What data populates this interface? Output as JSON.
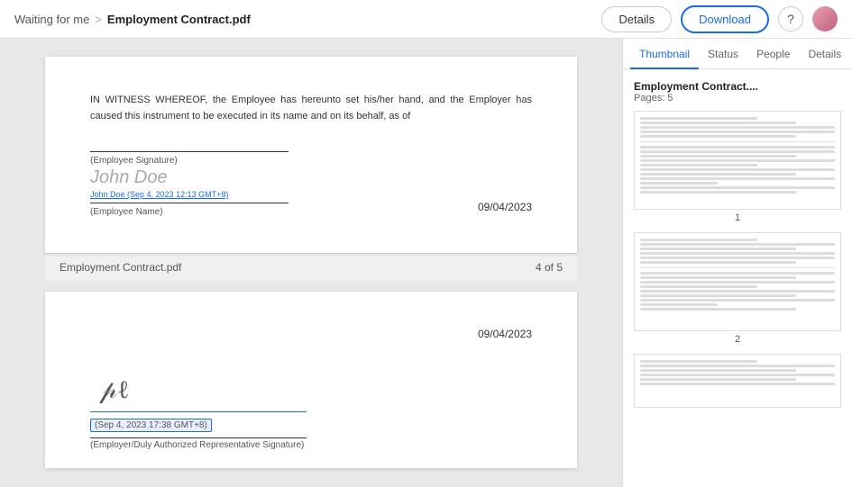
{
  "header": {
    "breadcrumb_waiting": "Waiting for me",
    "breadcrumb_separator": ">",
    "filename": "Employment Contract.pdf",
    "btn_details": "Details",
    "btn_download": "Download"
  },
  "panel": {
    "tab_thumbnail": "Thumbnail",
    "tab_status": "Status",
    "tab_people": "People",
    "tab_details": "Details",
    "doc_title": "Employment Contract....",
    "doc_pages": "Pages: 5",
    "thumb1_num": "1",
    "thumb2_num": "2",
    "thumb3_num": ""
  },
  "page4": {
    "body_text": "IN WITNESS WHEREOF, the Employee has hereunto set his/her hand, and the Employer has caused this instrument to be executed in its name and on its behalf, as of",
    "employee_signature_label": "(Employee Signature)",
    "signature_name": "John Doe",
    "signed_info": "John Doe (Sep 4, 2023 12:13 GMT+8)",
    "employee_name_label": "(Employee Name)",
    "date": "09/04/2023",
    "footer_filename": "Employment Contract.pdf",
    "footer_pages": "4 of 5"
  },
  "page5": {
    "date": "09/04/2023",
    "sig_date": "(Sep 4, 2023 17:38 GMT+8)",
    "employer_sig_label": "(Employer/Duly Authorized Representative Signature)"
  }
}
